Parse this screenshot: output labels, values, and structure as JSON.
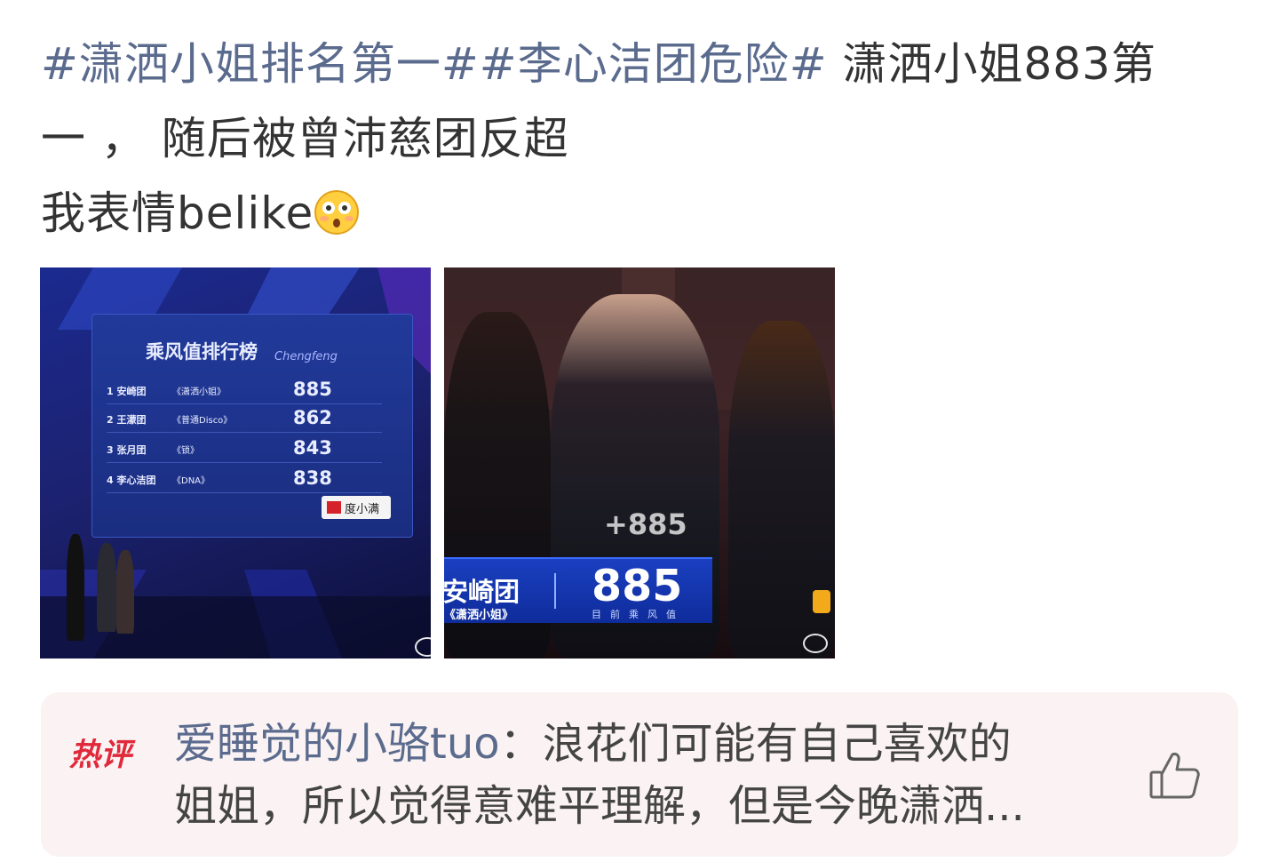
{
  "post": {
    "topic1": "#潇洒小姐排名第一#",
    "topic2": "#李心洁团危险#",
    "text_line1": " 潇洒小姐883第",
    "text_line2": "一 ，  随后被曾沛慈团反超",
    "text_line3": "我表情belike",
    "emoji": "flushed-face-emoji"
  },
  "image1": {
    "board_title": "乘风值排行榜",
    "board_script": "Chengfeng",
    "rows": [
      {
        "rank": "1 安崎团",
        "song": "《潇洒小姐》",
        "score": "885"
      },
      {
        "rank": "2 王濛团",
        "song": "《普通Disco》",
        "score": "862"
      },
      {
        "rank": "3 张月团",
        "song": "《锁》",
        "score": "843"
      },
      {
        "rank": "4 李心洁团",
        "song": "《DNA》",
        "score": "838"
      }
    ],
    "brand": "度小满"
  },
  "image2": {
    "plus_score": "+885",
    "group": "安崎团",
    "song": "《潇洒小姐》",
    "score": "885",
    "caption": "目前乘风值"
  },
  "hot_comment": {
    "label": "热评",
    "username": "爱睡觉的小骆tuo",
    "separator": "：",
    "line1": "浪花们可能有自己喜欢的",
    "line2": "姐姐，所以觉得意难平理解，但是今晚潇洒..."
  },
  "colors": {
    "topic": "#5b6b8e",
    "hot_label": "#e0293b",
    "comment_bg": "#fbf3f3"
  }
}
